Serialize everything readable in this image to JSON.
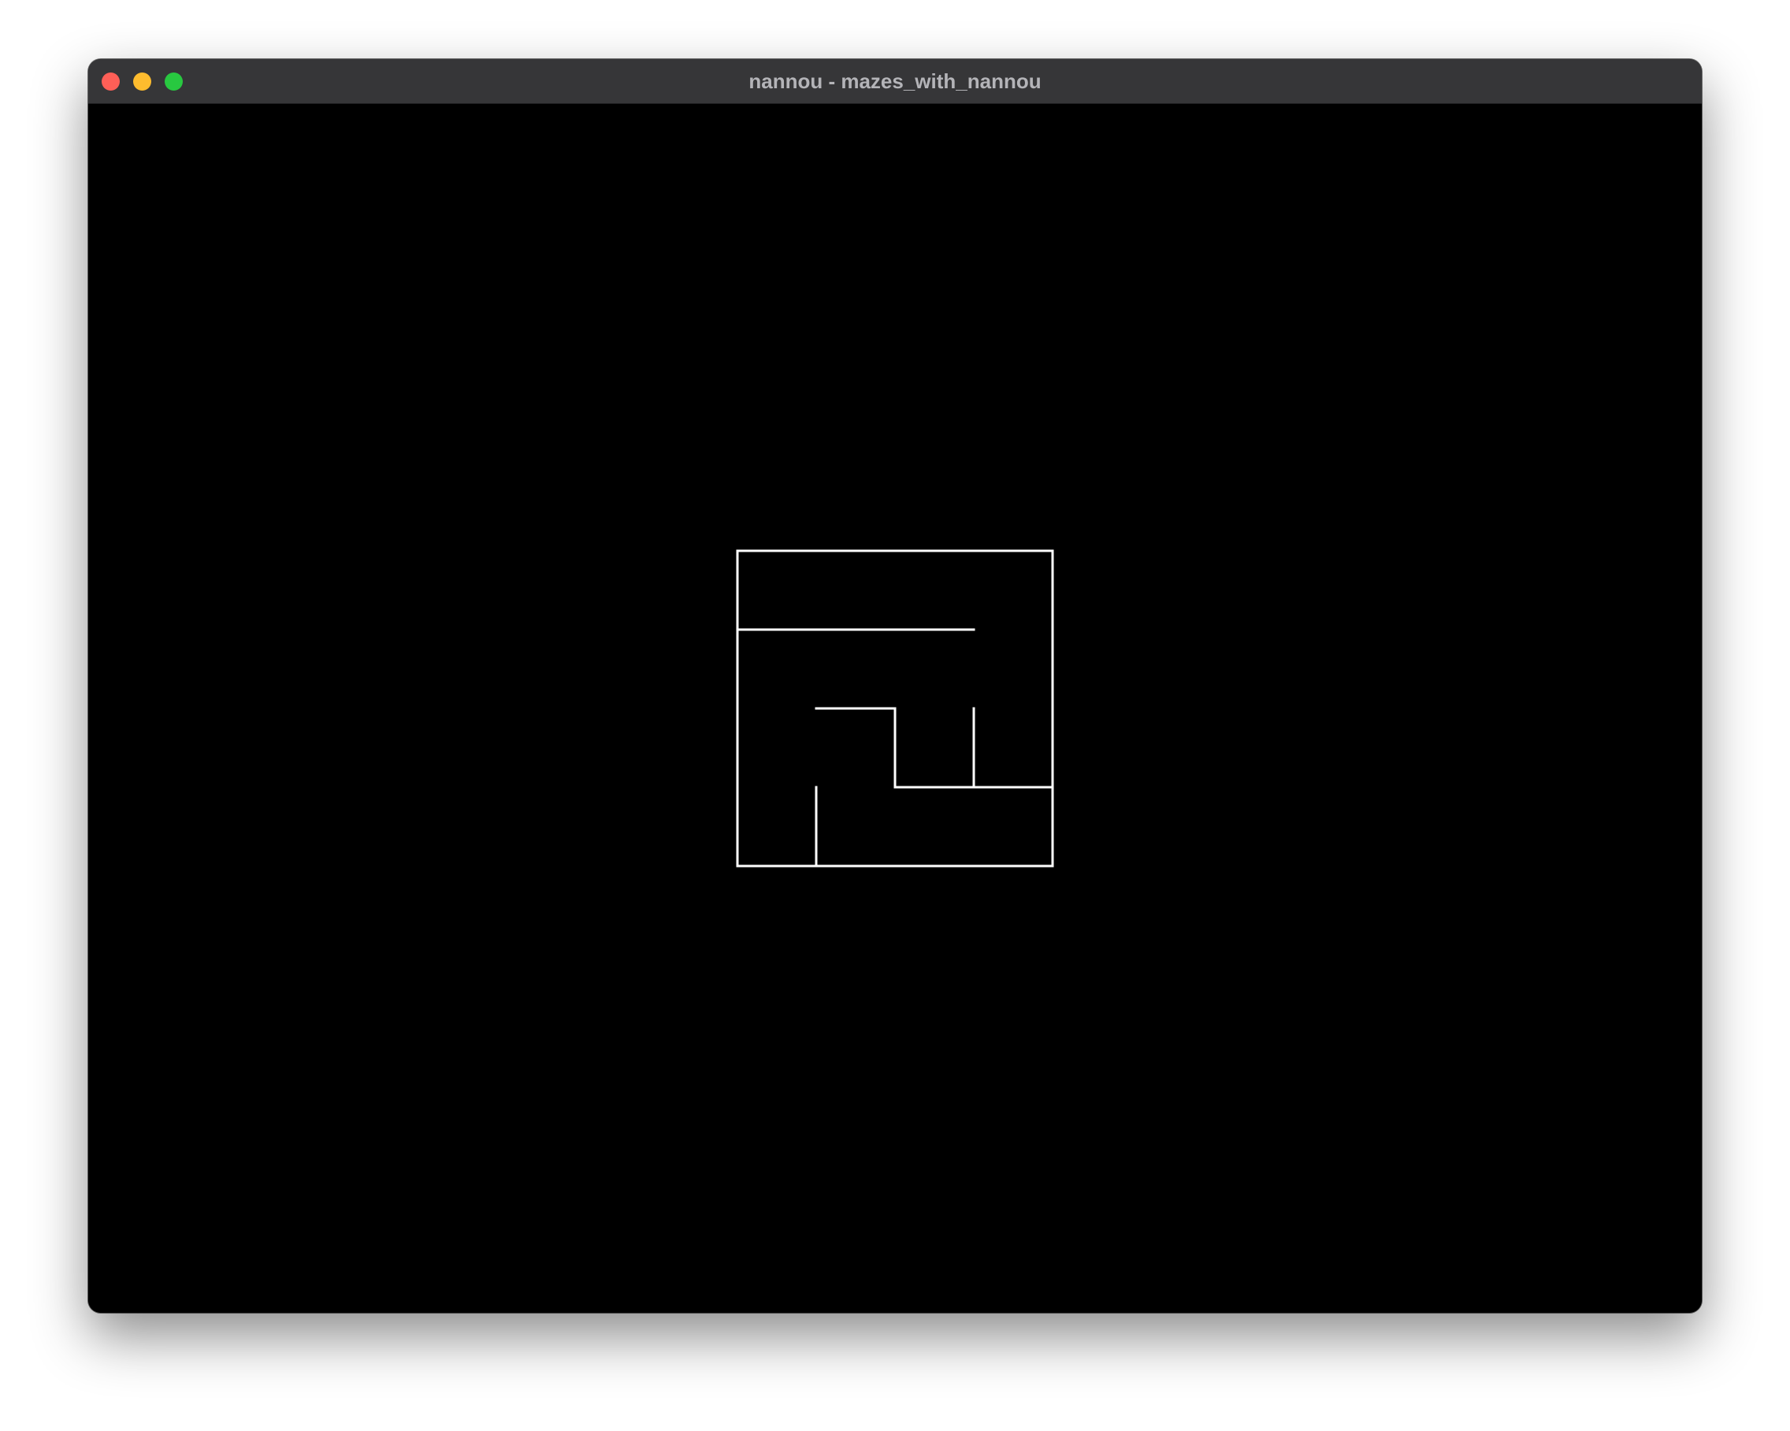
{
  "window": {
    "title": "nannou - mazes_with_nannou",
    "controls": {
      "close": "close-button",
      "minimize": "minimize-button",
      "maximize": "maximize-button"
    }
  },
  "colors": {
    "titlebar": "#363638",
    "title_text": "#b4b4b8",
    "canvas_background": "#000000",
    "maze_walls": "#ffffff",
    "close": "#fe5f57",
    "minimize": "#febc2e",
    "maximize": "#28c840"
  },
  "maze": {
    "rows": 4,
    "cols": 4,
    "walls": [
      {
        "from": [
          0,
          0
        ],
        "to": [
          4,
          0
        ]
      },
      {
        "from": [
          0,
          4
        ],
        "to": [
          4,
          4
        ]
      },
      {
        "from": [
          0,
          0
        ],
        "to": [
          0,
          4
        ]
      },
      {
        "from": [
          4,
          0
        ],
        "to": [
          4,
          4
        ]
      },
      {
        "from": [
          0,
          1
        ],
        "to": [
          3,
          1
        ]
      },
      {
        "from": [
          1,
          2
        ],
        "to": [
          2,
          2
        ]
      },
      {
        "from": [
          2,
          2
        ],
        "to": [
          2,
          3
        ]
      },
      {
        "from": [
          3,
          2
        ],
        "to": [
          3,
          3
        ]
      },
      {
        "from": [
          2,
          3
        ],
        "to": [
          4,
          3
        ]
      },
      {
        "from": [
          1,
          3
        ],
        "to": [
          1,
          4
        ]
      }
    ]
  }
}
